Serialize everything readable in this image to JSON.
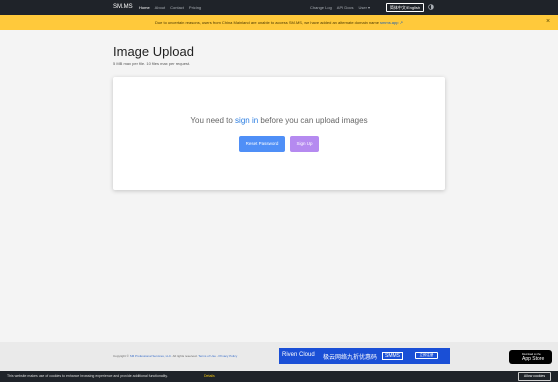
{
  "navbar": {
    "brand": "SM.MS",
    "links": [
      "Home",
      "About",
      "Contact",
      "Pricing"
    ],
    "right_links": [
      "Change Log",
      "API Docs",
      "User ▾"
    ],
    "lang_button": "简体中文/English",
    "theme_icon": "moon-icon"
  },
  "alert": {
    "text": "Due to uncertain reasons, users from China Mainland are unable to access SM.MS, we have added an alternate domain name ",
    "link": "smms.app",
    "link_icon": "↗",
    "close": "×"
  },
  "main": {
    "title": "Image Upload",
    "subtitle": "5 MB max per file. 10 files max per request."
  },
  "card": {
    "message_before": "You need to ",
    "message_link": "sign in",
    "message_after": " before you can upload images",
    "reset_button": "Reset Password",
    "signup_button": "Sign Up"
  },
  "footer": {
    "copyright_prefix": "Copyright © ",
    "company": "SM Professional Services, LLC",
    "rights": ". All rights reserved. ",
    "terms": "Terms of Use",
    "separator": " - ",
    "privacy": "Privacy Policy",
    "ad": {
      "brand": "Riven Cloud",
      "text": "极云网络九折优惠码",
      "tag": "SMMS",
      "button": "立即注册"
    },
    "appstore": {
      "small": "Download on the",
      "big": "App Store"
    }
  },
  "cookie": {
    "text": "This website makes use of cookies to enhance browsing experience and provide additional functionality.",
    "details": "Details",
    "allow": "Allow cookies"
  }
}
